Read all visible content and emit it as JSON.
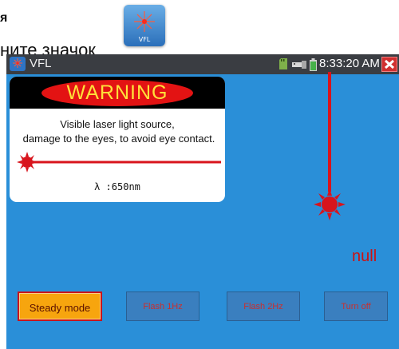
{
  "document": {
    "heading": "я",
    "line": "ните значок"
  },
  "desktop_icon": {
    "label": "VFL",
    "icon": "laser-burst-icon"
  },
  "app": {
    "title": "VFL",
    "time": "8:33:20 AM",
    "status_icons": [
      "sd-card-icon",
      "usb-icon",
      "battery-icon"
    ]
  },
  "warning": {
    "heading": "WARNING",
    "line1": "Visible laser light source,",
    "line2": "damage to the eyes, to avoid eye contact.",
    "wavelength": "λ :650nm"
  },
  "status_value": "null",
  "buttons": [
    {
      "label": "Steady mode",
      "state": "active"
    },
    {
      "label": "Flash 1Hz",
      "state": "inactive"
    },
    {
      "label": "Flash 2Hz",
      "state": "inactive"
    },
    {
      "label": "Turn off",
      "state": "inactive"
    }
  ],
  "colors": {
    "screen_bg": "#2a8fd8",
    "laser_red": "#d8141c",
    "warning_text": "#ffe03a",
    "active_button": "#f7a50e"
  }
}
